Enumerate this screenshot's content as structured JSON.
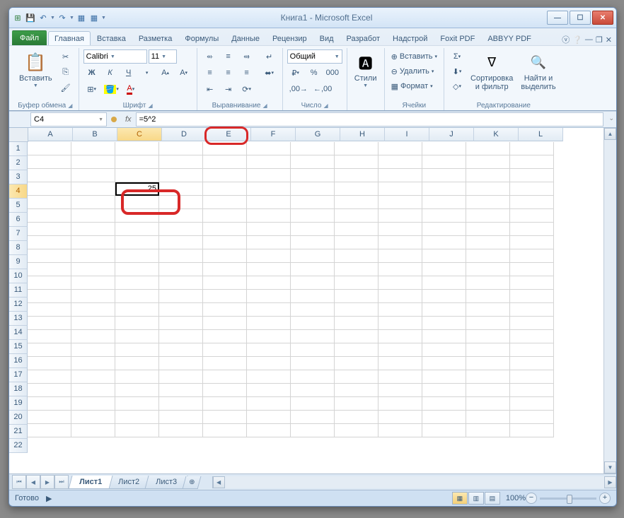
{
  "title": "Книга1  -  Microsoft Excel",
  "qat": {
    "save": "save",
    "undo": "undo",
    "redo": "redo"
  },
  "tabs": {
    "file": "Файл",
    "items": [
      "Главная",
      "Вставка",
      "Разметка",
      "Формулы",
      "Данные",
      "Рецензир",
      "Вид",
      "Разработ",
      "Надстрой",
      "Foxit PDF",
      "ABBYY PDF"
    ],
    "active": 0
  },
  "ribbon": {
    "clipboard": {
      "paste": "Вставить",
      "label": "Буфер обмена"
    },
    "font": {
      "name": "Calibri",
      "size": "11",
      "label": "Шрифт",
      "bold": "Ж",
      "italic": "К",
      "underline": "Ч"
    },
    "align": {
      "label": "Выравнивание"
    },
    "number": {
      "format": "Общий",
      "label": "Число"
    },
    "styles": {
      "btn": "Стили"
    },
    "cells": {
      "insert": "Вставить",
      "delete": "Удалить",
      "format": "Формат",
      "label": "Ячейки"
    },
    "editing": {
      "sort": "Сортировка\nи фильтр",
      "find": "Найти и\nвыделить",
      "label": "Редактирование"
    }
  },
  "namebox": "C4",
  "formula": "=5^2",
  "columns": [
    "A",
    "B",
    "C",
    "D",
    "E",
    "F",
    "G",
    "H",
    "I",
    "J",
    "K",
    "L"
  ],
  "rows": [
    "1",
    "2",
    "3",
    "4",
    "5",
    "6",
    "7",
    "8",
    "9",
    "10",
    "11",
    "12",
    "13",
    "14",
    "15",
    "16",
    "17",
    "18",
    "19",
    "20",
    "21",
    "22"
  ],
  "activeCol": 2,
  "activeRow": 3,
  "cellValue": "25",
  "sheets": {
    "items": [
      "Лист1",
      "Лист2",
      "Лист3"
    ],
    "active": 0
  },
  "status": "Готово",
  "zoom": "100%"
}
